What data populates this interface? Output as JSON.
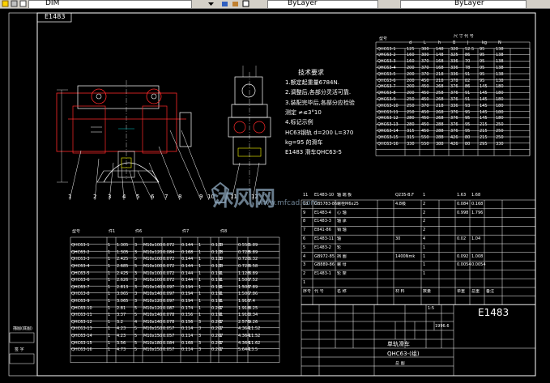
{
  "toolbar": {
    "layer_name": "DIM",
    "color_control": "ByLayer",
    "linetype_control": "ByLayer",
    "icons": [
      "layer-state-icon",
      "layers-icon",
      "color-swatch-icon",
      "linetype-icon"
    ]
  },
  "drawing": {
    "code_box": "E1483",
    "tech_title": "技术要求",
    "tech_notes": [
      "1.额定起重量6784N.",
      "2.调整后,各部分灵活可靠.",
      "3.装配完毕后,各部分应检验",
      "   测定  ≠≤3°10",
      "4.标记示例",
      "   HC63钢轨 d=200 L=370",
      "   kg=95 的滑车",
      "   E1483  滑车QHC63-5"
    ],
    "balloons": [
      "1",
      "2",
      "3",
      "4",
      "5",
      "6",
      "7",
      "8",
      "9",
      "10",
      "11",
      "12"
    ],
    "size_table": {
      "header_top": [
        "型号",
        "尺 寸 代 号"
      ],
      "columns": [
        "d",
        "L",
        "h",
        "B",
        "J",
        "kg",
        "N"
      ],
      "rows": [
        [
          "QHC63-1",
          "125",
          "300",
          "148",
          "320",
          "52.5",
          "95",
          "138"
        ],
        [
          "QHC63-2",
          "160",
          "300",
          "148",
          "325",
          "86",
          "95",
          "138"
        ],
        [
          "QHC63-3",
          "160",
          "370",
          "168",
          "336",
          "70",
          "95",
          "138"
        ],
        [
          "QHC63-4",
          "200",
          "370",
          "168",
          "336",
          "78",
          "95",
          "138"
        ],
        [
          "QHC63-5",
          "200",
          "370",
          "218",
          "336",
          "91",
          "95",
          "138"
        ],
        [
          "QHC63-6",
          "200",
          "450",
          "218",
          "378",
          "82",
          "95",
          "138"
        ],
        [
          "QHC63-7",
          "200",
          "450",
          "268",
          "376",
          "86",
          "145",
          "180"
        ],
        [
          "QHC63-8",
          "200",
          "450",
          "258",
          "376",
          "91",
          "145",
          "180"
        ],
        [
          "QHC63-9",
          "250",
          "450",
          "268",
          "376",
          "91",
          "145",
          "180"
        ],
        [
          "QHC63-10",
          "250",
          "370",
          "218",
          "336",
          "93",
          "145",
          "180"
        ],
        [
          "QHC63-11",
          "250",
          "450",
          "268",
          "376",
          "95",
          "145",
          "180"
        ],
        [
          "QHC63-12",
          "280",
          "450",
          "268",
          "376",
          "95",
          "145",
          "180"
        ],
        [
          "QHC63-13",
          "280",
          "450",
          "288",
          "376",
          "95",
          "215",
          "250"
        ],
        [
          "QHC63-14",
          "315",
          "450",
          "288",
          "376",
          "95",
          "215",
          "250"
        ],
        [
          "QHC63-15",
          "315",
          "550",
          "288",
          "426",
          "80",
          "215",
          "250"
        ],
        [
          "QHC63-16",
          "330",
          "550",
          "388",
          "426",
          "80",
          "295",
          "330"
        ]
      ]
    },
    "parts_table": {
      "rows": [
        [
          "11",
          "E1483-10",
          "轴 端 板",
          "",
          "Q235-B.F",
          "1",
          "",
          "1.63",
          "1.68",
          ""
        ],
        [
          "10",
          "GB5783-86",
          "螺栓M6x25",
          "",
          "4.8级",
          "2",
          "",
          "0.084",
          "0.168",
          ""
        ],
        [
          "9",
          "E1483-4",
          "心 轴",
          "",
          "",
          "2",
          "",
          "0.998",
          "1.796",
          ""
        ],
        [
          "8",
          "E1483-3",
          "轴 承",
          "",
          "",
          "2",
          "",
          "",
          "",
          ""
        ],
        [
          "7",
          "E841-86",
          "销 轴",
          "",
          "",
          "2",
          "",
          "",
          "",
          ""
        ],
        [
          "6",
          "E1483-11",
          "轴",
          "",
          "30",
          "4",
          "",
          "0.02",
          "1.04",
          ""
        ],
        [
          "5",
          "E1483-2",
          "轮",
          "",
          "",
          "1",
          "",
          "",
          "",
          ""
        ],
        [
          "4",
          "GB972-85",
          "挡 圈",
          "",
          "1400Nmk",
          "1",
          "",
          "0.092",
          "1.008",
          ""
        ],
        [
          "3",
          "GB889-86",
          "螺 母",
          "",
          "",
          "1",
          "",
          "0.0054",
          "0.0054",
          ""
        ],
        [
          "2",
          "E1483-1",
          "轮 架",
          "",
          "",
          "1",
          "",
          "",
          "",
          ""
        ],
        [
          "1",
          "",
          "",
          "",
          "",
          "",
          "",
          "",
          "",
          ""
        ]
      ],
      "header": [
        "序号",
        "代 号",
        "名 称",
        "",
        "材 料",
        "数量",
        "",
        "单重",
        "总重",
        "备注"
      ]
    },
    "title_block": {
      "drawing_number": "E1483",
      "date": "1996.6",
      "ratio": "1:5",
      "title": "单轨滑车",
      "model": "QHC63-",
      "model_suffix": "(组)",
      "sheet": "总 图"
    },
    "var_table": {
      "header": [
        "型号",
        "件1",
        "",
        "件6",
        "",
        "",
        "件7",
        "",
        "",
        "件8",
        "",
        ""
      ],
      "rows": [
        [
          "QHC63-1",
          "1",
          "1.305",
          "3",
          "M10x100",
          "0.072",
          "0.144",
          "1",
          "0.128",
          "1",
          "0.558",
          "5.89"
        ],
        [
          "QHC63-2",
          "1",
          "1.305",
          "3",
          "M10x120",
          "0.084",
          "0.168",
          "1",
          "0.128",
          "1",
          "0.728",
          "5.89"
        ],
        [
          "QHC63-3",
          "1",
          "2.425",
          "5",
          "M10x100",
          "0.072",
          "0.144",
          "1",
          "0.128",
          "1",
          "0.728",
          "6.32"
        ],
        [
          "QHC63-4",
          "1",
          "2.685",
          "5",
          "M10x100",
          "0.072",
          "0.144",
          "1",
          "0.128",
          "1",
          "0.728",
          "6.58"
        ],
        [
          "QHC63-5",
          "1",
          "2.425",
          "3",
          "M10x100",
          "0.072",
          "0.144",
          "1",
          "0.191",
          "1",
          "1.126",
          "6.89"
        ],
        [
          "QHC63-6",
          "1",
          "2.626",
          "3",
          "M10x100",
          "0.072",
          "0.144",
          "1",
          "0.191",
          "1",
          "1.506",
          "7.52"
        ],
        [
          "QHC63-7",
          "1",
          "2.813",
          "3",
          "M10x140",
          "0.097",
          "0.194",
          "1",
          "0.191",
          "1",
          "1.506",
          "7.89"
        ],
        [
          "QHC63-8",
          "1",
          "3.065",
          "3",
          "M10x140",
          "0.097",
          "0.194",
          "1",
          "0.191",
          "1",
          "1.506",
          "7.86"
        ],
        [
          "QHC63-9",
          "1",
          "3.065",
          "3",
          "M10x120",
          "0.097",
          "0.194",
          "1",
          "0.191",
          "1",
          "1.916",
          "7.4"
        ],
        [
          "QHC63-10",
          "1",
          "2.81",
          "5",
          "M10x120",
          "0.087",
          "0.174",
          "1",
          "0.267",
          "1",
          "1.918",
          "8.25"
        ],
        [
          "QHC63-11",
          "1",
          "3.37",
          "5",
          "M10x140",
          "0.078",
          "0.156",
          "1",
          "0.191",
          "1",
          "1.916",
          "8.34"
        ],
        [
          "QHC63-12",
          "1",
          "3.2",
          "4",
          "M10x140",
          "0.078",
          "0.156",
          "3",
          "0.267",
          "1",
          "2.576",
          "9.26"
        ],
        [
          "QHC63-13",
          "1",
          "4.23",
          "5",
          "M10x150",
          "0.057",
          "0.114",
          "3",
          "0.267",
          "1",
          "4.364",
          "11.52"
        ],
        [
          "QHC63-14",
          "1",
          "4.23",
          "5",
          "M10x150",
          "0.057",
          "0.114",
          "3",
          "0.267",
          "1",
          "4.364",
          "11.52"
        ],
        [
          "QHC63-15",
          "1",
          "3.56",
          "5",
          "M10x180",
          "0.084",
          "0.168",
          "3",
          "0.267",
          "1",
          "4.364",
          "11.62"
        ],
        [
          "QHC63-16",
          "1",
          "4.73",
          "5",
          "M10x150",
          "0.057",
          "0.114",
          "3",
          "0.267",
          "1",
          "5.644",
          "13.5"
        ]
      ]
    },
    "side_label": "描图(底图)",
    "side_label2": "签 字"
  },
  "watermark": {
    "text": "沐风网",
    "url": "www.mfcad.com"
  },
  "colors": {
    "background": "#000000",
    "lines": "#ffffff",
    "section": "#ff2a2a",
    "hidden": "#00c8c8",
    "accent": "#ffff00"
  }
}
